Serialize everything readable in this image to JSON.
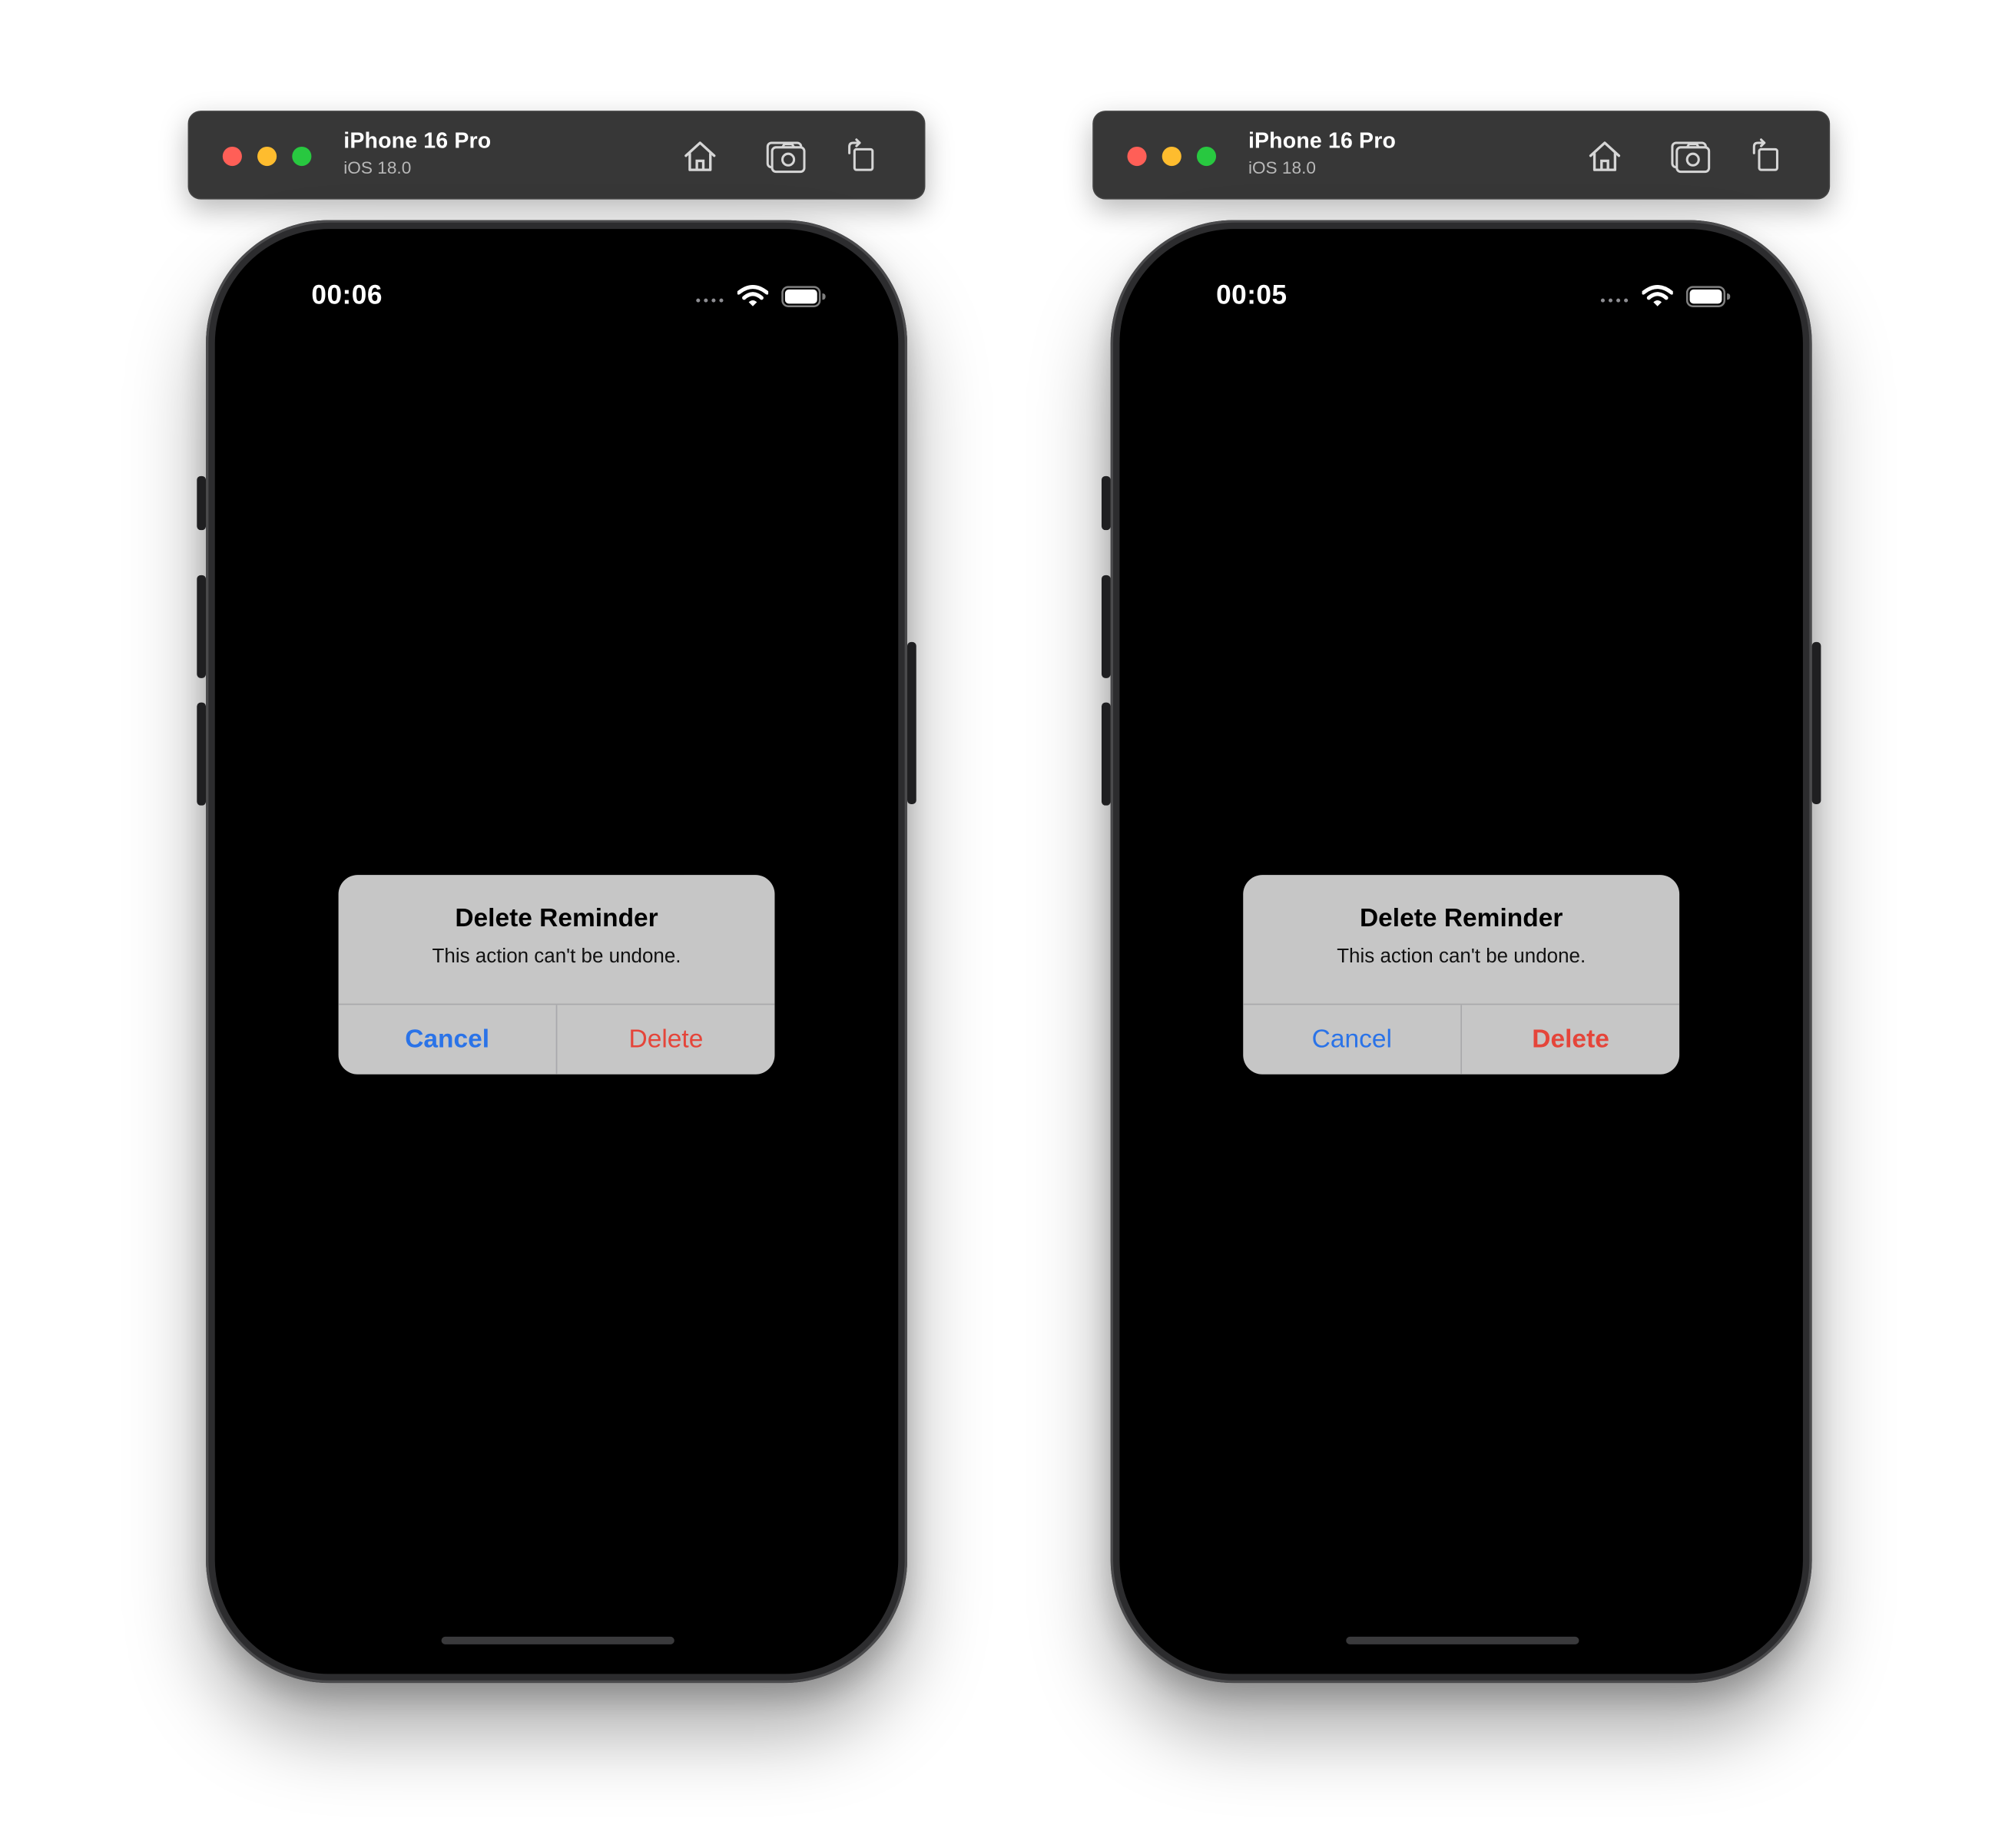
{
  "colors": {
    "cancel_blue": "#2a73e8",
    "destructive_red": "#e5453a",
    "alert_background": "#c6c6c6",
    "titlebar_background": "#373737"
  },
  "simulators": [
    {
      "window": {
        "device_name": "iPhone 16 Pro",
        "os_version": "iOS 18.0",
        "toolbar_icons": [
          "home-icon",
          "screenshot-icon",
          "rotate-icon"
        ]
      },
      "status_bar": {
        "time": "00:06"
      },
      "alert": {
        "title": "Delete Reminder",
        "message": "This action can't be undone.",
        "cancel_label": "Cancel",
        "delete_label": "Delete",
        "emphasized_button": "Cancel"
      }
    },
    {
      "window": {
        "device_name": "iPhone 16 Pro",
        "os_version": "iOS 18.0",
        "toolbar_icons": [
          "home-icon",
          "screenshot-icon",
          "rotate-icon"
        ]
      },
      "status_bar": {
        "time": "00:05"
      },
      "alert": {
        "title": "Delete Reminder",
        "message": "This action can't be undone.",
        "cancel_label": "Cancel",
        "delete_label": "Delete",
        "emphasized_button": "Delete"
      }
    }
  ]
}
